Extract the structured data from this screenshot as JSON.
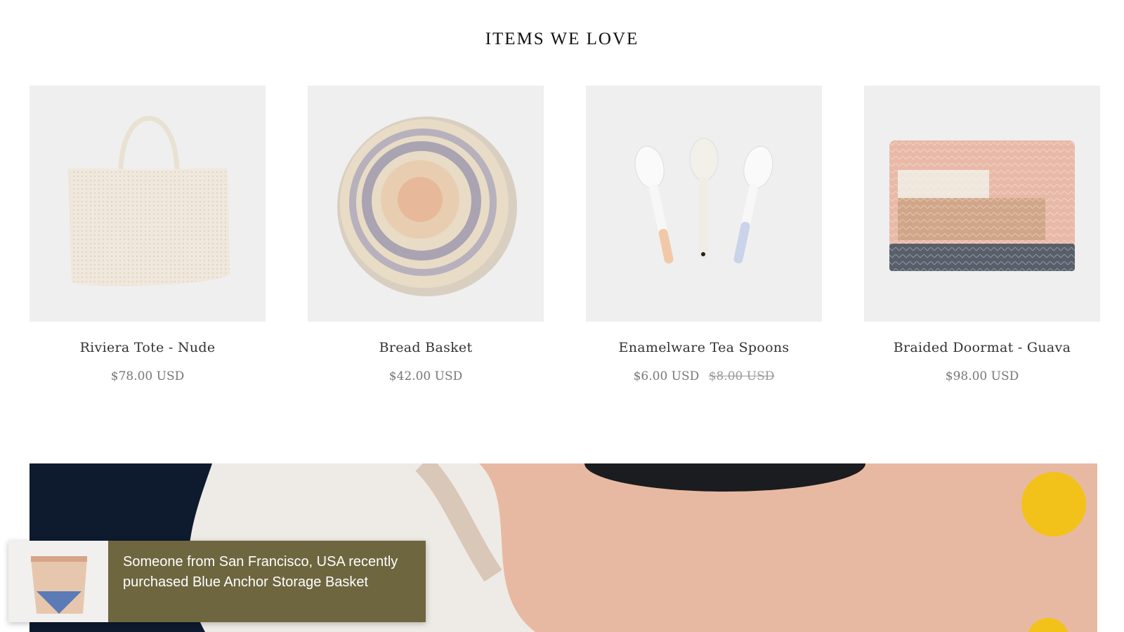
{
  "section": {
    "title": "ITEMS WE LOVE"
  },
  "products": [
    {
      "name": "Riviera Tote - Nude",
      "price": "$78.00 USD",
      "compare_price": ""
    },
    {
      "name": "Bread Basket",
      "price": "$42.00 USD",
      "compare_price": ""
    },
    {
      "name": "Enamelware Tea Spoons",
      "price": "$6.00 USD",
      "compare_price": "$8.00 USD"
    },
    {
      "name": "Braided Doormat - Guava",
      "price": "$98.00 USD",
      "compare_price": ""
    }
  ],
  "toast": {
    "line1": "Someone from San Francisco, USA recently",
    "line2": "purchased Blue Anchor Storage Basket"
  },
  "colors": {
    "toast_bg": "#6e663f",
    "product_image_bg": "#efefef",
    "banner_peach": "#e8b9a2",
    "banner_navy": "#0e1a2e"
  }
}
